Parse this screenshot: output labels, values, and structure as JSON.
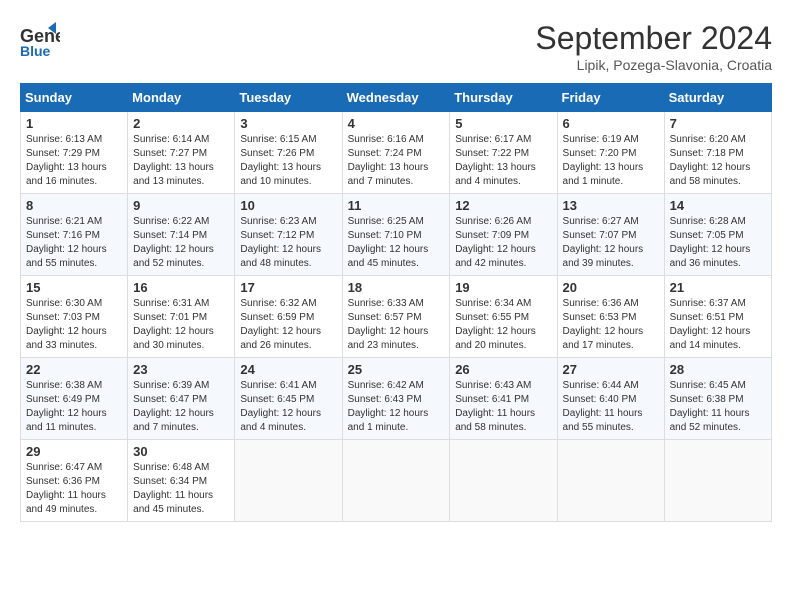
{
  "header": {
    "logo_line1": "General",
    "logo_line2": "Blue",
    "month_title": "September 2024",
    "subtitle": "Lipik, Pozega-Slavonia, Croatia"
  },
  "weekdays": [
    "Sunday",
    "Monday",
    "Tuesday",
    "Wednesday",
    "Thursday",
    "Friday",
    "Saturday"
  ],
  "weeks": [
    [
      {
        "day": "1",
        "info": "Sunrise: 6:13 AM\nSunset: 7:29 PM\nDaylight: 13 hours\nand 16 minutes."
      },
      {
        "day": "2",
        "info": "Sunrise: 6:14 AM\nSunset: 7:27 PM\nDaylight: 13 hours\nand 13 minutes."
      },
      {
        "day": "3",
        "info": "Sunrise: 6:15 AM\nSunset: 7:26 PM\nDaylight: 13 hours\nand 10 minutes."
      },
      {
        "day": "4",
        "info": "Sunrise: 6:16 AM\nSunset: 7:24 PM\nDaylight: 13 hours\nand 7 minutes."
      },
      {
        "day": "5",
        "info": "Sunrise: 6:17 AM\nSunset: 7:22 PM\nDaylight: 13 hours\nand 4 minutes."
      },
      {
        "day": "6",
        "info": "Sunrise: 6:19 AM\nSunset: 7:20 PM\nDaylight: 13 hours\nand 1 minute."
      },
      {
        "day": "7",
        "info": "Sunrise: 6:20 AM\nSunset: 7:18 PM\nDaylight: 12 hours\nand 58 minutes."
      }
    ],
    [
      {
        "day": "8",
        "info": "Sunrise: 6:21 AM\nSunset: 7:16 PM\nDaylight: 12 hours\nand 55 minutes."
      },
      {
        "day": "9",
        "info": "Sunrise: 6:22 AM\nSunset: 7:14 PM\nDaylight: 12 hours\nand 52 minutes."
      },
      {
        "day": "10",
        "info": "Sunrise: 6:23 AM\nSunset: 7:12 PM\nDaylight: 12 hours\nand 48 minutes."
      },
      {
        "day": "11",
        "info": "Sunrise: 6:25 AM\nSunset: 7:10 PM\nDaylight: 12 hours\nand 45 minutes."
      },
      {
        "day": "12",
        "info": "Sunrise: 6:26 AM\nSunset: 7:09 PM\nDaylight: 12 hours\nand 42 minutes."
      },
      {
        "day": "13",
        "info": "Sunrise: 6:27 AM\nSunset: 7:07 PM\nDaylight: 12 hours\nand 39 minutes."
      },
      {
        "day": "14",
        "info": "Sunrise: 6:28 AM\nSunset: 7:05 PM\nDaylight: 12 hours\nand 36 minutes."
      }
    ],
    [
      {
        "day": "15",
        "info": "Sunrise: 6:30 AM\nSunset: 7:03 PM\nDaylight: 12 hours\nand 33 minutes."
      },
      {
        "day": "16",
        "info": "Sunrise: 6:31 AM\nSunset: 7:01 PM\nDaylight: 12 hours\nand 30 minutes."
      },
      {
        "day": "17",
        "info": "Sunrise: 6:32 AM\nSunset: 6:59 PM\nDaylight: 12 hours\nand 26 minutes."
      },
      {
        "day": "18",
        "info": "Sunrise: 6:33 AM\nSunset: 6:57 PM\nDaylight: 12 hours\nand 23 minutes."
      },
      {
        "day": "19",
        "info": "Sunrise: 6:34 AM\nSunset: 6:55 PM\nDaylight: 12 hours\nand 20 minutes."
      },
      {
        "day": "20",
        "info": "Sunrise: 6:36 AM\nSunset: 6:53 PM\nDaylight: 12 hours\nand 17 minutes."
      },
      {
        "day": "21",
        "info": "Sunrise: 6:37 AM\nSunset: 6:51 PM\nDaylight: 12 hours\nand 14 minutes."
      }
    ],
    [
      {
        "day": "22",
        "info": "Sunrise: 6:38 AM\nSunset: 6:49 PM\nDaylight: 12 hours\nand 11 minutes."
      },
      {
        "day": "23",
        "info": "Sunrise: 6:39 AM\nSunset: 6:47 PM\nDaylight: 12 hours\nand 7 minutes."
      },
      {
        "day": "24",
        "info": "Sunrise: 6:41 AM\nSunset: 6:45 PM\nDaylight: 12 hours\nand 4 minutes."
      },
      {
        "day": "25",
        "info": "Sunrise: 6:42 AM\nSunset: 6:43 PM\nDaylight: 12 hours\nand 1 minute."
      },
      {
        "day": "26",
        "info": "Sunrise: 6:43 AM\nSunset: 6:41 PM\nDaylight: 11 hours\nand 58 minutes."
      },
      {
        "day": "27",
        "info": "Sunrise: 6:44 AM\nSunset: 6:40 PM\nDaylight: 11 hours\nand 55 minutes."
      },
      {
        "day": "28",
        "info": "Sunrise: 6:45 AM\nSunset: 6:38 PM\nDaylight: 11 hours\nand 52 minutes."
      }
    ],
    [
      {
        "day": "29",
        "info": "Sunrise: 6:47 AM\nSunset: 6:36 PM\nDaylight: 11 hours\nand 49 minutes."
      },
      {
        "day": "30",
        "info": "Sunrise: 6:48 AM\nSunset: 6:34 PM\nDaylight: 11 hours\nand 45 minutes."
      },
      {
        "day": "",
        "info": ""
      },
      {
        "day": "",
        "info": ""
      },
      {
        "day": "",
        "info": ""
      },
      {
        "day": "",
        "info": ""
      },
      {
        "day": "",
        "info": ""
      }
    ]
  ]
}
